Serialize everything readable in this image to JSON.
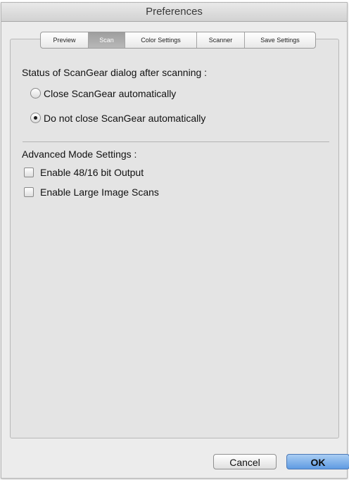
{
  "window": {
    "title": "Preferences"
  },
  "tabs": [
    {
      "label": "Preview"
    },
    {
      "label": "Scan"
    },
    {
      "label": "Color Settings"
    },
    {
      "label": "Scanner"
    },
    {
      "label": "Save Settings"
    }
  ],
  "selected_tab": "Scan",
  "scan": {
    "status_heading": "Status of ScanGear dialog after scanning :",
    "options": [
      {
        "label": "Close ScanGear automatically",
        "selected": false
      },
      {
        "label": "Do not close ScanGear automatically",
        "selected": true
      }
    ],
    "advanced_heading": "Advanced Mode Settings :",
    "checkboxes": [
      {
        "label": "Enable 48/16 bit Output",
        "checked": false
      },
      {
        "label": "Enable Large Image Scans",
        "checked": false
      }
    ]
  },
  "buttons": {
    "cancel": "Cancel",
    "ok": "OK"
  },
  "colors": {
    "accent": "#5f9be2",
    "selected_tab": "#a8a8a8",
    "background": "#ececec"
  }
}
